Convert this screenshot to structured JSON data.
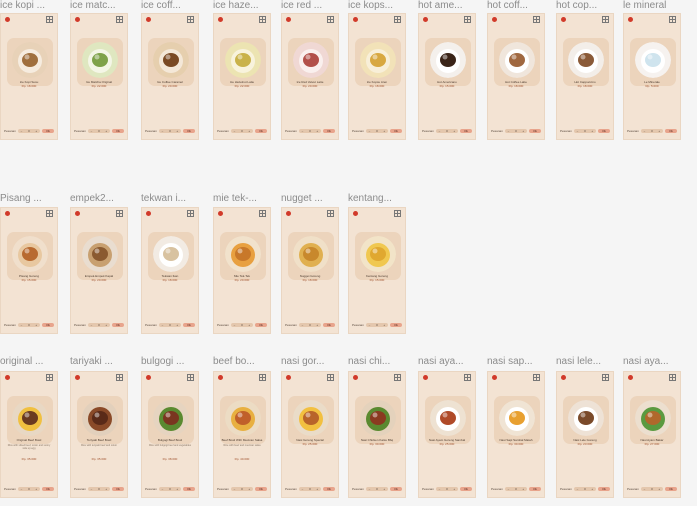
{
  "rows": [
    {
      "frames": [
        {
          "label": "ice kopi ...",
          "photo": "iced-coffee-glass",
          "name": "Ice Kopi Susu",
          "price": "Rp. 18.000",
          "desc": ""
        },
        {
          "label": "ice matc...",
          "photo": "iced-matcha-glass",
          "name": "Ice Matcha Original",
          "price": "Rp. 22.000",
          "desc": ""
        },
        {
          "label": "ice coff...",
          "photo": "iced-coffee-latte-glass",
          "name": "Ice Coffee Caramel",
          "price": "Rp. 20.000",
          "desc": ""
        },
        {
          "label": "ice haze...",
          "photo": "iced-hazelnut-glass",
          "name": "Ice Hazelnut Latte",
          "price": "Rp. 22.000",
          "desc": ""
        },
        {
          "label": "ice red ...",
          "photo": "iced-red-velvet-glass",
          "name": "Ice Red Velvet Latte",
          "price": "Rp. 20.000",
          "desc": ""
        },
        {
          "label": "ice kops...",
          "photo": "iced-kopsu-cup",
          "name": "Ice Kopsu Aren",
          "price": "Rp. 18.000",
          "desc": ""
        },
        {
          "label": "hot ame...",
          "photo": "hot-americano-cup",
          "name": "Hot Americano",
          "price": "Rp. 15.000",
          "desc": ""
        },
        {
          "label": "hot coff...",
          "photo": "hot-coffee-latte-art",
          "name": "Hot Coffee Latte",
          "price": "Rp. 18.000",
          "desc": ""
        },
        {
          "label": "hot cop...",
          "photo": "hot-cappuccino-cup",
          "name": "Hot Cappuccino",
          "price": "Rp. 18.000",
          "desc": ""
        },
        {
          "label": "le mineral",
          "photo": "mineral-water-bottle",
          "name": "Le Minerale",
          "price": "Rp. 5.000",
          "desc": ""
        }
      ]
    },
    {
      "frames": [
        {
          "label": "Pisang ...",
          "photo": "fried-banana",
          "name": "Pisang Goreng",
          "price": "Rp. 15.000",
          "desc": ""
        },
        {
          "label": "empek2...",
          "photo": "pempek-bowl",
          "name": "Empek-Empek Kapal",
          "price": "Rp. 20.000",
          "desc": ""
        },
        {
          "label": "tekwan i...",
          "photo": "tekwan-soup-bowl",
          "name": "Tekwan Ikan",
          "price": "Rp. 18.000",
          "desc": ""
        },
        {
          "label": "mie tek-...",
          "photo": "fried-noodles-plate",
          "name": "Mie Tek-Tek",
          "price": "Rp. 20.000",
          "desc": ""
        },
        {
          "label": "nugget ...",
          "photo": "nugget-plate",
          "name": "Nugget Goreng",
          "price": "Rp. 18.000",
          "desc": ""
        },
        {
          "label": "kentang...",
          "photo": "french-fries",
          "name": "Kentang Goreng",
          "price": "Rp. 15.000",
          "desc": ""
        }
      ]
    },
    {
      "frames": [
        {
          "label": "original ...",
          "photo": "rice-bowl-egg",
          "name": "Original Beef Bowl",
          "price": "Rp. 35.000",
          "desc": "Rice with sliced beef, onion and sunny side up egg"
        },
        {
          "label": "tariyaki ...",
          "photo": "teriyaki-beef-bowl",
          "name": "Teriyaki Beef Bowl",
          "price": "Rp. 35.000",
          "desc": "Rice with teriyaki beef and onion"
        },
        {
          "label": "bulgogi ...",
          "photo": "bulgogi-beef-bowl",
          "name": "Bulgogi Beef Bowl",
          "price": "Rp. 38.000",
          "desc": "Rice with bulgogi beef and vegetables"
        },
        {
          "label": "beef bo...",
          "photo": "beef-bowl-salsa",
          "name": "Beef Bowl With Mexican Salsa",
          "price": "Rp. 40.000",
          "desc": "Rice with beef and mexican salsa"
        },
        {
          "label": "nasi gor...",
          "photo": "fried-rice-egg",
          "name": "Nasi Goreng Special",
          "price": "Rp. 25.000",
          "desc": ""
        },
        {
          "label": "nasi chi...",
          "photo": "chicken-rice-bowl",
          "name": "Nasi Chicken Katsu Bbq",
          "price": "Rp. 30.000",
          "desc": ""
        },
        {
          "label": "nasi aya...",
          "photo": "chicken-rice-plate",
          "name": "Nasi Ayam Goreng Sambal",
          "price": "Rp. 25.000",
          "desc": ""
        },
        {
          "label": "nasi sap...",
          "photo": "rice-egg-plate",
          "name": "Nasi Sapi Sambal Matah",
          "price": "Rp. 30.000",
          "desc": ""
        },
        {
          "label": "nasi lele...",
          "photo": "catfish-rice-plate",
          "name": "Nasi Lele Goreng",
          "price": "Rp. 23.000",
          "desc": ""
        },
        {
          "label": "nasi aya...",
          "photo": "chicken-egg-plate",
          "name": "Nasi Ayam Bakar",
          "price": "Rp. 27.000",
          "desc": ""
        }
      ]
    }
  ],
  "card_footer": {
    "qty_label": "Pesanan",
    "minus": "−",
    "qty_value": "0",
    "plus": "+",
    "add_label": "Ok"
  },
  "colors": {
    "canvas_bg": "#f5f5f5",
    "card_bg": "#f3e3d3",
    "accent": "#d13a2a"
  }
}
